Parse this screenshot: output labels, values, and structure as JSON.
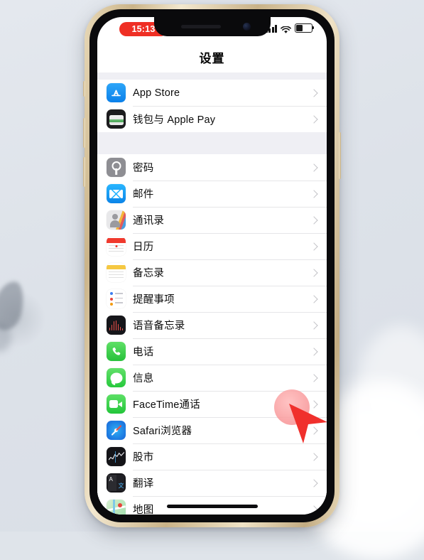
{
  "device": {
    "frame": "iphone-gold",
    "frame_color": "#cbb489"
  },
  "status_bar": {
    "time": "15:13",
    "time_pill_color": "#ef2f24",
    "cellular_icon": "signal-bars-icon",
    "wifi_icon": "wifi-icon",
    "battery_icon": "battery-icon",
    "battery_level_percent": 45
  },
  "nav": {
    "title": "设置"
  },
  "sections": [
    {
      "id": "store-section",
      "rows": [
        {
          "label": "App Store",
          "icon": "app-store-icon",
          "icon_class": "ic-appstore",
          "chevron": "chevron-right-icon"
        },
        {
          "label": "钱包与 Apple Pay",
          "icon": "wallet-icon",
          "icon_class": "ic-wallet",
          "chevron": "chevron-right-icon"
        }
      ]
    },
    {
      "id": "apps-section",
      "rows": [
        {
          "label": "密码",
          "icon": "passwords-icon",
          "icon_class": "ic-passwords",
          "chevron": "chevron-right-icon"
        },
        {
          "label": "邮件",
          "icon": "mail-icon",
          "icon_class": "ic-mail",
          "chevron": "chevron-right-icon"
        },
        {
          "label": "通讯录",
          "icon": "contacts-icon",
          "icon_class": "ic-contacts",
          "chevron": "chevron-right-icon"
        },
        {
          "label": "日历",
          "icon": "calendar-icon",
          "icon_class": "ic-calendar",
          "chevron": "chevron-right-icon"
        },
        {
          "label": "备忘录",
          "icon": "notes-icon",
          "icon_class": "ic-notes",
          "chevron": "chevron-right-icon"
        },
        {
          "label": "提醒事项",
          "icon": "reminders-icon",
          "icon_class": "ic-reminders",
          "chevron": "chevron-right-icon"
        },
        {
          "label": "语音备忘录",
          "icon": "voice-memos-icon",
          "icon_class": "ic-voicememos",
          "chevron": "chevron-right-icon"
        },
        {
          "label": "电话",
          "icon": "phone-icon",
          "icon_class": "ic-phone",
          "chevron": "chevron-right-icon"
        },
        {
          "label": "信息",
          "icon": "messages-icon",
          "icon_class": "ic-messages",
          "chevron": "chevron-right-icon"
        },
        {
          "label": "FaceTime通话",
          "icon": "facetime-icon",
          "icon_class": "ic-facetime",
          "chevron": "chevron-right-icon"
        },
        {
          "label": "Safari浏览器",
          "icon": "safari-icon",
          "icon_class": "ic-safari",
          "chevron": "chevron-right-icon"
        },
        {
          "label": "股市",
          "icon": "stocks-icon",
          "icon_class": "ic-stocks",
          "chevron": "chevron-right-icon"
        },
        {
          "label": "翻译",
          "icon": "translate-icon",
          "icon_class": "ic-translate",
          "chevron": "chevron-right-icon"
        },
        {
          "label": "地图",
          "icon": "maps-icon",
          "icon_class": "ic-maps",
          "chevron": "chevron-right-icon"
        }
      ]
    }
  ],
  "overlays": {
    "touch_circle": {
      "name": "touch-indicator-circle",
      "color": "#c4c4c9"
    },
    "tap_dot": {
      "name": "tap-highlight-dot",
      "color": "#f8969a"
    },
    "cursor": {
      "name": "mouse-cursor-arrow",
      "color": "#f0302c"
    }
  },
  "home_indicator": "home-indicator"
}
